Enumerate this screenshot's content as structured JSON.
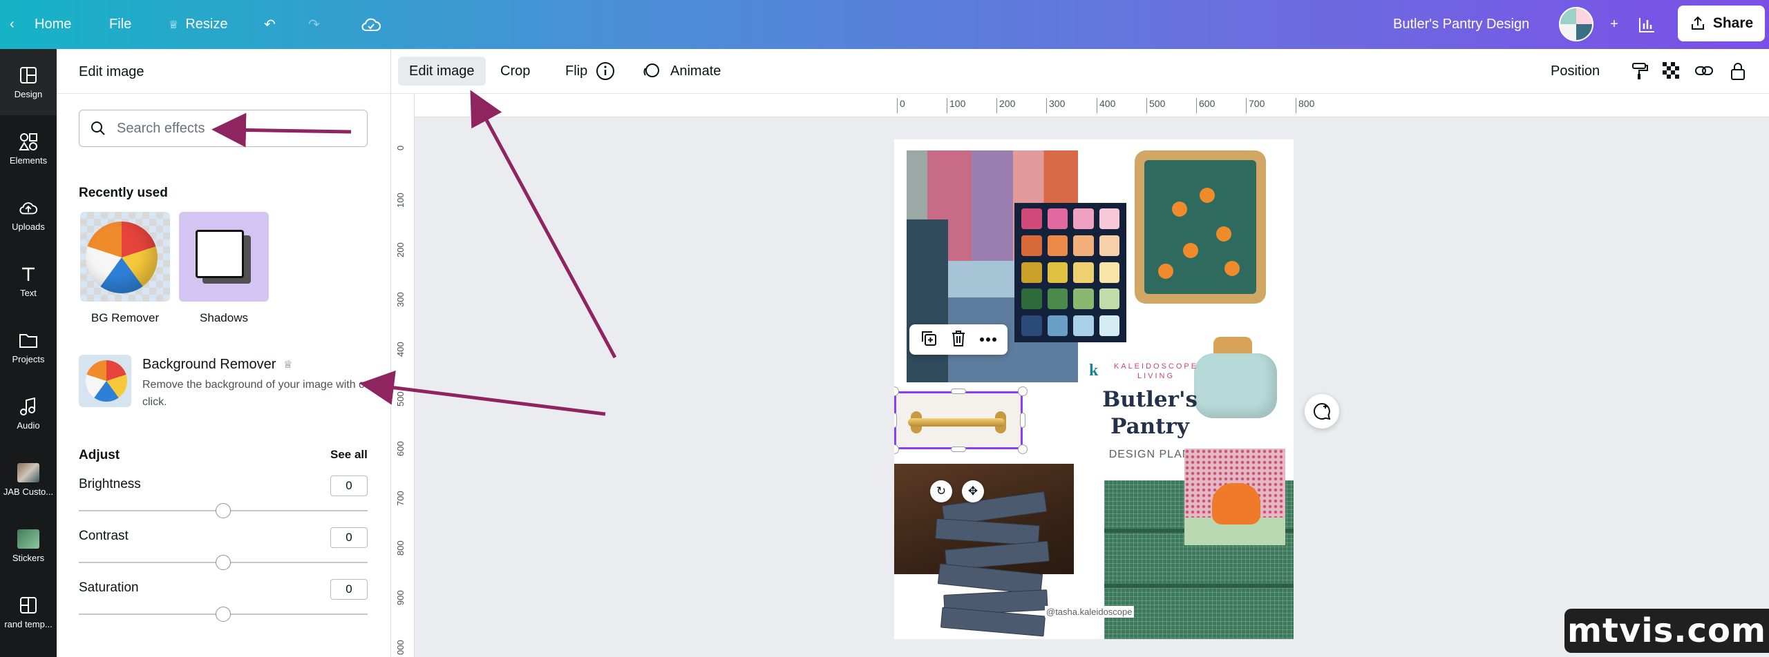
{
  "topbar": {
    "home_label": "Home",
    "file_label": "File",
    "resize_label": "Resize",
    "design_title": "Butler's Pantry Design",
    "share_label": "Share",
    "icons": [
      "back-chevron-icon",
      "crown-icon",
      "undo-icon",
      "redo-icon",
      "cloud-saved-icon",
      "avatar",
      "plus-icon",
      "analytics-icon",
      "share-upload-icon"
    ]
  },
  "rail": {
    "items": [
      {
        "label": "Design",
        "icon": "layout-icon"
      },
      {
        "label": "Elements",
        "icon": "shapes-icon"
      },
      {
        "label": "Uploads",
        "icon": "cloud-upload-icon"
      },
      {
        "label": "Text",
        "icon": "text-icon"
      },
      {
        "label": "Projects",
        "icon": "folder-icon"
      },
      {
        "label": "Audio",
        "icon": "music-note-icon"
      },
      {
        "label": "JAB Custo...",
        "icon": "app-thumbnail-icon"
      },
      {
        "label": "Stickers",
        "icon": "sticker-thumbnail-icon"
      },
      {
        "label": "rand temp...",
        "icon": "template-icon"
      }
    ]
  },
  "panel": {
    "title": "Edit image",
    "search_placeholder": "Search effects",
    "recently_used_heading": "Recently used",
    "recent": [
      {
        "label": "BG Remover"
      },
      {
        "label": "Shadows"
      }
    ],
    "feature": {
      "title": "Background Remover",
      "description": "Remove the background of your image with one click."
    },
    "adjust_heading": "Adjust",
    "see_all_label": "See all",
    "adjustments": [
      {
        "label": "Brightness",
        "value": "0"
      },
      {
        "label": "Contrast",
        "value": "0"
      },
      {
        "label": "Saturation",
        "value": "0"
      }
    ]
  },
  "context_toolbar": {
    "edit_image_label": "Edit image",
    "crop_label": "Crop",
    "flip_label": "Flip",
    "animate_label": "Animate",
    "position_label": "Position"
  },
  "ruler": {
    "top_ticks": [
      "0",
      "100",
      "200",
      "300",
      "400",
      "500",
      "600",
      "700",
      "800"
    ],
    "left_ticks": [
      "0",
      "100",
      "200",
      "300",
      "400",
      "500",
      "600",
      "700",
      "800",
      "900",
      "000"
    ]
  },
  "canvas": {
    "brand_mark": "k",
    "brand_line1": "KALEIDOSCOPE",
    "brand_line2": "LIVING",
    "title_line1": "Butler's",
    "title_line2": "Pantry",
    "subtitle": "DESIGN PLAN",
    "credit": "@tasha.kaleidoscope"
  },
  "watermark": "mtvis.com",
  "colors": {
    "selection": "#8b3dff",
    "annotation_arrow": "#8e2561",
    "rail_bg": "#18191b"
  }
}
